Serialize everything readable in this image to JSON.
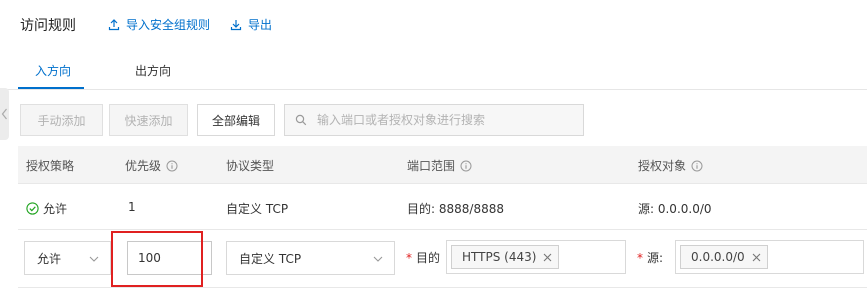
{
  "header": {
    "title": "访问规则",
    "import_label": "导入安全组规则",
    "export_label": "导出"
  },
  "tabs": [
    {
      "label": "入方向",
      "active": true
    },
    {
      "label": "出方向",
      "active": false
    }
  ],
  "toolbar": {
    "manual_add": "手动添加",
    "quick_add": "快速添加",
    "edit_all": "全部编辑",
    "search_placeholder": "输入端口或者授权对象进行搜索"
  },
  "table": {
    "headers": [
      "授权策略",
      "优先级",
      "协议类型",
      "端口范围",
      "授权对象"
    ],
    "rows": [
      {
        "policy": "允许",
        "priority": "1",
        "protocol": "自定义 TCP",
        "port": "目的: 8888/8888",
        "object": "源: 0.0.0.0/0"
      }
    ]
  },
  "edit_row": {
    "policy_value": "允许",
    "priority_value": "100",
    "protocol_value": "自定义 TCP",
    "dest_label": "目的",
    "dest_tag": "HTTPS (443)",
    "source_label": "源:",
    "source_tag": "0.0.0.0/0"
  },
  "colors": {
    "accent": "#0070cc",
    "success": "#1fa31f",
    "highlight_frame": "#e02020",
    "required": "#e02020"
  },
  "icons": [
    "upload-icon",
    "download-icon",
    "search-icon",
    "info-icon",
    "check-circle-icon",
    "chevron-down-icon",
    "close-icon",
    "chevron-left-icon"
  ]
}
